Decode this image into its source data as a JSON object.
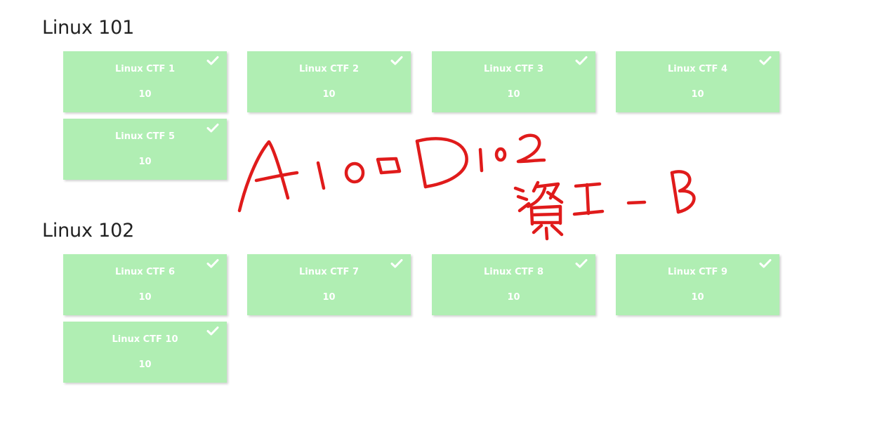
{
  "categories": [
    {
      "title": "Linux 101",
      "challenges": [
        {
          "name": "Linux CTF 1",
          "value": "10",
          "solved": true
        },
        {
          "name": "Linux CTF 2",
          "value": "10",
          "solved": true
        },
        {
          "name": "Linux CTF 3",
          "value": "10",
          "solved": true
        },
        {
          "name": "Linux CTF 4",
          "value": "10",
          "solved": true
        },
        {
          "name": "Linux CTF 5",
          "value": "10",
          "solved": true
        }
      ]
    },
    {
      "title": "Linux 102",
      "challenges": [
        {
          "name": "Linux CTF 6",
          "value": "10",
          "solved": true
        },
        {
          "name": "Linux CTF 7",
          "value": "10",
          "solved": true
        },
        {
          "name": "Linux CTF 8",
          "value": "10",
          "solved": true
        },
        {
          "name": "Linux CTF 9",
          "value": "10",
          "solved": true
        },
        {
          "name": "Linux CTF 10",
          "value": "10",
          "solved": true
        }
      ]
    }
  ],
  "handwritten_annotation": {
    "lines": [
      "A100D102",
      "資1-B"
    ],
    "color": "#e01b1b"
  },
  "colors": {
    "tile_solved": "#b0eeb3",
    "tile_text": "#ffffff"
  },
  "icons": {
    "solved": "check-icon"
  }
}
